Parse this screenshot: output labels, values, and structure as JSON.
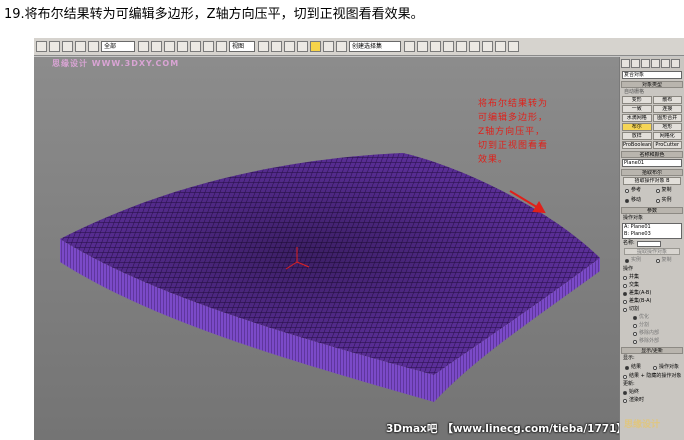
{
  "caption": "19.将布尔结果转为可编辑多边形，Z轴方向压平，切到正视图看看效果。",
  "toolbar": {
    "selection_filter": "全部",
    "reference_coord": "视图",
    "named_selection": "创建选择集",
    "highlight_color": "#f7d44a"
  },
  "viewport": {
    "watermark": "思缘设计 WWW.3DXY.COM",
    "background_color": "#818181",
    "mesh_color": "#6a3fb0",
    "annotation_lines": [
      "将布尔结果转为",
      "可编辑多边形，",
      "Z轴方向压平，",
      "切到正视图看看",
      "效果。"
    ],
    "annotation_color": "#e0201a",
    "footer_parts": [
      "3Dmax吧",
      "【www.linecg.com/tieba/1771】"
    ]
  },
  "panel": {
    "category_dropdown": "复合对象",
    "object_type_header": "对象类型",
    "autogrid_label": "自动栅格",
    "buttons": [
      "变形",
      "散布",
      "一致",
      "连接",
      "水滴网格",
      "图形合并",
      "布尔",
      "地形",
      "放样",
      "网格化",
      "ProBoolean",
      "ProCutter"
    ],
    "active_button": "布尔",
    "name_color_header": "名称和颜色",
    "object_name": "Plane01",
    "pick_boolean_header": "拾取布尔",
    "pick_operand_button": "拾取操作对象 B",
    "pick_modes": [
      "参考",
      "复制",
      "移动",
      "实例"
    ],
    "pick_mode_active": "移动",
    "params_header": "参数",
    "operands_label": "操作对象",
    "operand_list": [
      "A: Plane01",
      "B: Plane03"
    ],
    "name_label": "名称:",
    "extract_button": "提取操作对象",
    "extract_modes": [
      "实例",
      "复制"
    ],
    "operation_label": "操作",
    "operations": [
      "并集",
      "交集",
      "差集(A-B)",
      "差集(B-A)",
      "切割"
    ],
    "operation_active": "差集(A-B)",
    "cut_modes": [
      "优化",
      "分割",
      "移除内部",
      "移除外部"
    ],
    "display_update_header": "显示/更新",
    "display_label": "显示:",
    "display_modes": [
      "结果",
      "操作对象",
      "结果 + 隐藏的操作对象"
    ],
    "display_active": "结果",
    "update_label": "更新:",
    "update_modes": [
      "始终",
      "渲染时"
    ],
    "update_active": "始终",
    "logo_text": "思缘设计"
  }
}
